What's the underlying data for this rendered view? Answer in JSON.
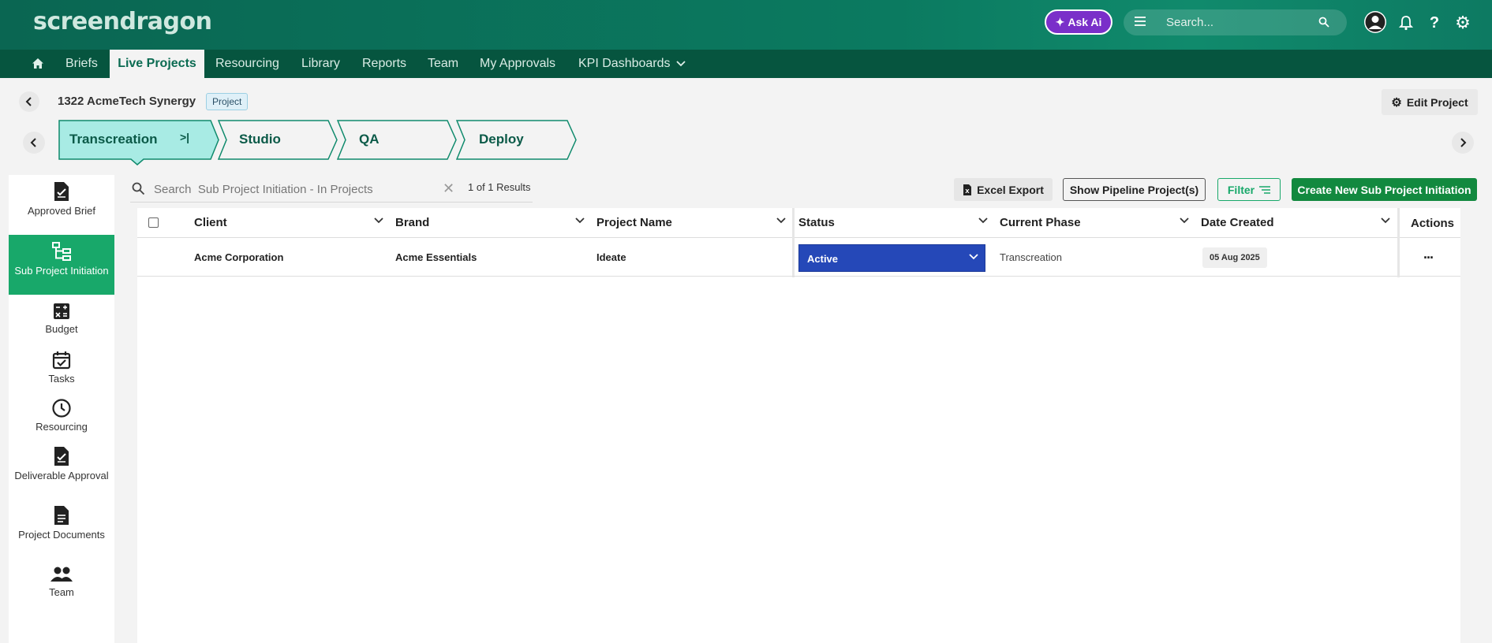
{
  "app": {
    "logo": "screendragon",
    "ask_ai": "Ask Ai",
    "search_placeholder": "Search..."
  },
  "nav": {
    "items": [
      "Briefs",
      "Live Projects",
      "Resourcing",
      "Library",
      "Reports",
      "Team",
      "My Approvals",
      "KPI Dashboards"
    ],
    "active": "Live Projects"
  },
  "project": {
    "title": "1322 AcmeTech Synergy",
    "badge": "Project",
    "edit_label": "Edit Project"
  },
  "phases": [
    "Transcreation",
    "Studio",
    "QA",
    "Deploy"
  ],
  "sidebar": {
    "items": [
      "Approved Brief",
      "Sub Project Initiation",
      "Budget",
      "Tasks",
      "Resourcing",
      "Deliverable Approval",
      "Project Documents",
      "Team"
    ],
    "active": "Sub Project Initiation"
  },
  "toolbar": {
    "search_placeholder": "Search  Sub Project Initiation - In Projects",
    "results": "1 of 1 Results",
    "excel_export": "Excel Export",
    "show_pipeline": "Show Pipeline Project(s)",
    "filter": "Filter",
    "create": "Create New Sub Project Initiation"
  },
  "table": {
    "columns": [
      "Client",
      "Brand",
      "Project Name",
      "Status",
      "Current Phase",
      "Date Created",
      "Actions"
    ],
    "rows": [
      {
        "client": "Acme Corporation",
        "brand": "Acme Essentials",
        "project_name": "Ideate",
        "status": "Active",
        "current_phase": "Transcreation",
        "date_created": "05 Aug 2025",
        "actions": "..."
      }
    ]
  },
  "colors": {
    "header_green": "#0a6652",
    "nav_green": "#06553f",
    "accent_green": "#18a86a",
    "create_green": "#12893f",
    "status_blue": "#2548b8",
    "ask_ai_purple": "#7a2fc9",
    "active_phase_fill": "#a8ebe4"
  }
}
